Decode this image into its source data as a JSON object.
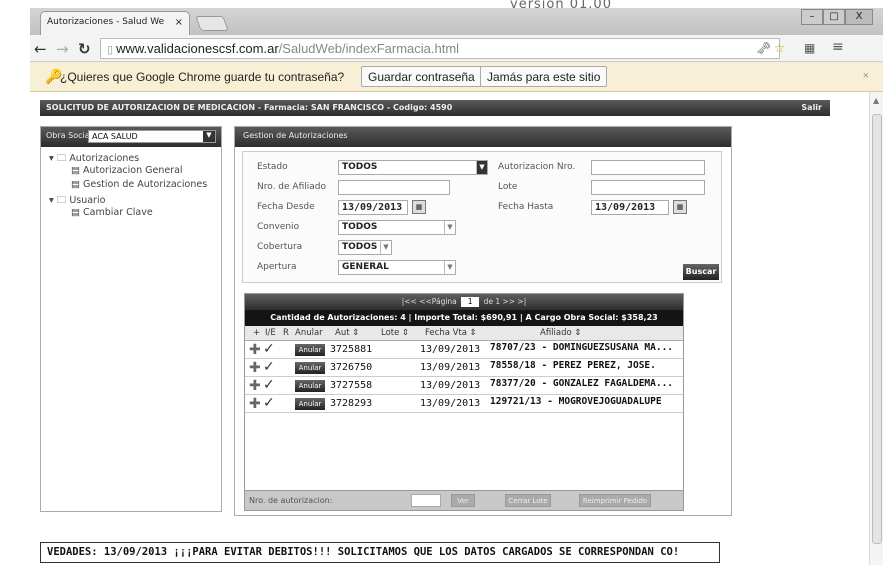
{
  "version_label": "versión 01.00",
  "browser": {
    "tab_title": "Autorizaciones - Salud We",
    "tab_close": "×",
    "url_host": "www.validacionescsf.com.ar",
    "url_path": "/SaludWeb/indexFarmacia.html",
    "window_controls": {
      "min": "–",
      "max": "□",
      "close": "X"
    }
  },
  "infobar": {
    "question": "¿Quieres que Google Chrome guarde tu contraseña?",
    "save_button": "Guardar contraseña",
    "never_button": "Jamás para este sitio",
    "close": "×"
  },
  "app": {
    "header": "SOLICITUD DE AUTORIZACION DE MEDICACION - Farmacia: SAN FRANCISCO - Codigo: 4590",
    "salir": "Salir"
  },
  "sidebar": {
    "obra_social_label": "Obra Social",
    "obra_social_value": "ACA SALUD",
    "tree": [
      {
        "label": "Autorizaciones",
        "level": 1
      },
      {
        "label": "Autorizacion General",
        "level": 2
      },
      {
        "label": "Gestion de Autorizaciones",
        "level": 2
      },
      {
        "label": "Usuario",
        "level": 1
      },
      {
        "label": "Cambiar Clave",
        "level": 2
      }
    ]
  },
  "panel": {
    "title": "Gestion de Autorizaciones",
    "form": {
      "estado_label": "Estado",
      "estado_value": "TODOS",
      "autorizacion_nro_label": "Autorizacion Nro.",
      "nro_afiliado_label": "Nro. de Afiliado",
      "lote_label": "Lote",
      "fecha_desde_label": "Fecha Desde",
      "fecha_desde_value": "13/09/2013",
      "fecha_hasta_label": "Fecha Hasta",
      "fecha_hasta_value": "13/09/2013",
      "convenio_label": "Convenio",
      "convenio_value": "TODOS",
      "cobertura_label": "Cobertura",
      "cobertura_value": "TODOS",
      "apertura_label": "Apertura",
      "apertura_value": "GENERAL",
      "buscar": "Buscar"
    },
    "grid": {
      "pager_left": "|<< <<Página",
      "page": "1",
      "pager_right": "de 1 >> >|",
      "summary": "Cantidad de Autorizaciones: 4 | Importe Total: $690,91 | A Cargo Obra Social: $358,23",
      "columns": [
        "+",
        "I/E",
        "R",
        "Anular",
        "Aut ⇕",
        "Lote ⇕",
        "Fecha Vta ⇕",
        "Afiliado ⇕"
      ],
      "anular_label": "Anular",
      "rows": [
        {
          "aut": "3725881",
          "lote": "",
          "fecha": "13/09/2013",
          "afiliado": "78707/23 - DOMINGUEZSUSANA MA..."
        },
        {
          "aut": "3726750",
          "lote": "",
          "fecha": "13/09/2013",
          "afiliado": "78558/18 - PEREZ PEREZ, JOSE."
        },
        {
          "aut": "3727558",
          "lote": "",
          "fecha": "13/09/2013",
          "afiliado": "78377/20 - GONZALEZ FAGALDEMA..."
        },
        {
          "aut": "3728293",
          "lote": "",
          "fecha": "13/09/2013",
          "afiliado": "129721/13 - MOGROVEJOGUADALUPE"
        }
      ],
      "footer_label": "Nro. de autorizacion:",
      "footer_buttons": [
        "Ver",
        "Cerrar Lote",
        "Reimprimir Pedido"
      ]
    }
  },
  "ticker": "VEDADES: 13/09/2013  ¡¡¡PARA EVITAR DEBITOS!!! SOLICITAMOS QUE LOS DATOS CARGADOS SE CORRESPONDAN CO!"
}
